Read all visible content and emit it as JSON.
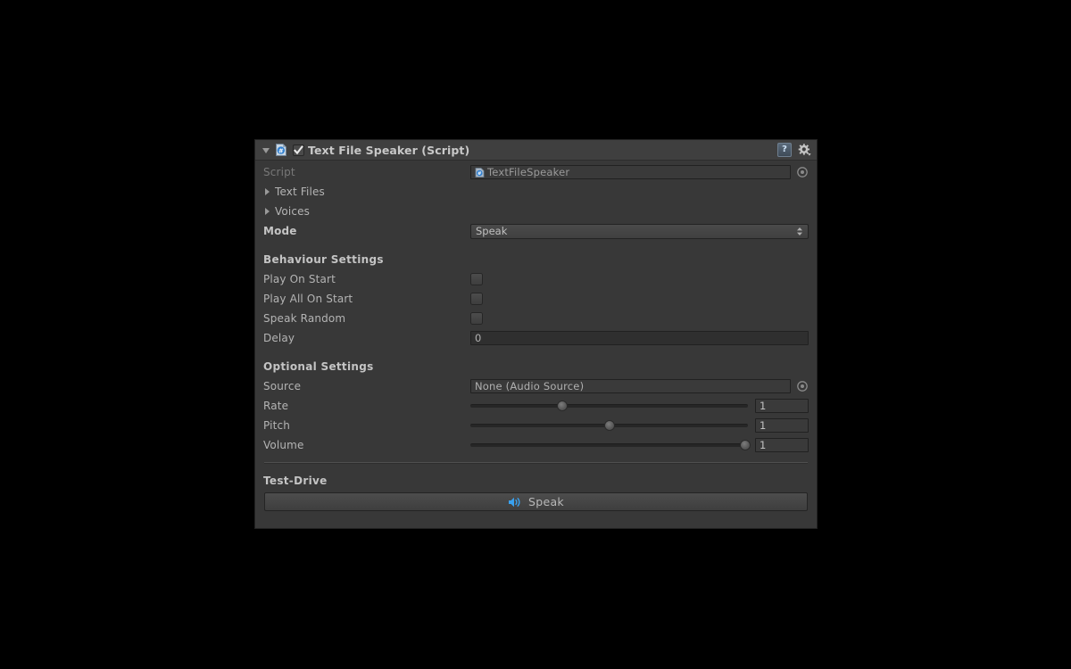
{
  "component": {
    "title": "Text File Speaker (Script)",
    "enabled_checkbox": "checked",
    "icon": "cs-script-icon",
    "help_icon": "help-icon",
    "help_glyph": "?",
    "gear_icon": "gear-icon",
    "foldout": "expanded"
  },
  "fields": {
    "script": {
      "label": "Script",
      "value": "TextFileSpeaker",
      "icon": "cs-script-icon",
      "picker_icon": "object-picker-icon"
    },
    "text_files": {
      "label": "Text Files",
      "foldout": "collapsed"
    },
    "voices": {
      "label": "Voices",
      "foldout": "collapsed"
    },
    "mode": {
      "label": "Mode",
      "value": "Speak",
      "options": [
        "Speak"
      ],
      "arrow_icon": "updown-arrows-icon"
    }
  },
  "behaviour_settings": {
    "title": "Behaviour Settings",
    "toggles": [
      {
        "label": "Play On Start",
        "checked": false
      },
      {
        "label": "Play All On Start",
        "checked": false
      },
      {
        "label": "Speak Random",
        "checked": false
      }
    ],
    "delay": {
      "label": "Delay",
      "value": "0"
    }
  },
  "optional_settings": {
    "title": "Optional Settings",
    "source": {
      "label": "Source",
      "value": "None (Audio Source)",
      "picker_icon": "object-picker-icon"
    },
    "sliders": [
      {
        "label": "Rate",
        "value": "1",
        "percent": 33
      },
      {
        "label": "Pitch",
        "value": "1",
        "percent": 50
      },
      {
        "label": "Volume",
        "value": "1",
        "percent": 99
      }
    ]
  },
  "test_drive": {
    "title": "Test-Drive",
    "speak_button": {
      "label": "Speak",
      "icon": "speaker-icon"
    }
  },
  "colors": {
    "panel_bg": "#383838",
    "header_bg": "#3f3f3f",
    "field_bg": "#2f2f2f",
    "accent_blue": "#39a1ef",
    "text": "#b4b4b4"
  }
}
